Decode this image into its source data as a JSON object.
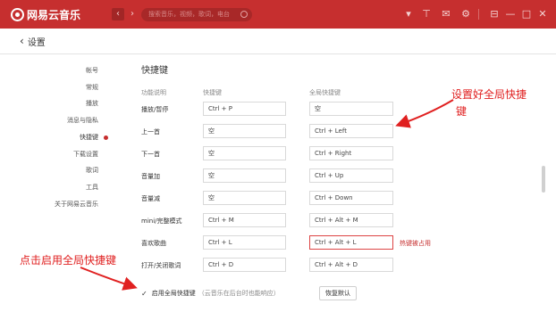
{
  "app": {
    "name": "网易云音乐"
  },
  "titlebar": {
    "search_placeholder": "搜索音乐，视频，歌词，电台",
    "back_glyph": "‹",
    "forward_glyph": "›",
    "icons": {
      "dropdown": "▾",
      "skin": "⊤",
      "mail": "✉",
      "settings": "⚙",
      "mini": "⊟",
      "minimize": "—",
      "maximize": "□",
      "close": "✕"
    }
  },
  "header": {
    "back_glyph": "‹",
    "title": "设置"
  },
  "sidebar": {
    "items": [
      {
        "label": "帐号"
      },
      {
        "label": "常规"
      },
      {
        "label": "播放"
      },
      {
        "label": "消息与隐私"
      },
      {
        "label": "快捷键",
        "active": true
      },
      {
        "label": "下载设置"
      },
      {
        "label": "歌词"
      },
      {
        "label": "工具"
      },
      {
        "label": "关于网易云音乐"
      }
    ]
  },
  "shortcuts": {
    "title": "快捷键",
    "col_function": "功能说明",
    "col_local": "快捷键",
    "col_global": "全局快捷键",
    "rows": [
      {
        "label": "播放/暂停",
        "local": "Ctrl + P",
        "global": "空"
      },
      {
        "label": "上一首",
        "local": "空",
        "global": "Ctrl + Left"
      },
      {
        "label": "下一首",
        "local": "空",
        "global": "Ctrl + Right"
      },
      {
        "label": "音量加",
        "local": "空",
        "global": "Ctrl + Up"
      },
      {
        "label": "音量减",
        "local": "空",
        "global": "Ctrl + Down"
      },
      {
        "label": "mini/完整模式",
        "local": "Ctrl + M",
        "global": "Ctrl + Alt + M"
      },
      {
        "label": "喜欢歌曲",
        "local": "Ctrl + L",
        "global": "Ctrl + Alt + L",
        "conflict": true
      },
      {
        "label": "打开/关闭歌词",
        "local": "Ctrl + D",
        "global": "Ctrl + Alt + D"
      }
    ],
    "conflict_text": "热键被占用",
    "enable_checkbox": {
      "checked": true,
      "check_glyph": "✓",
      "label": "启用全局快捷键",
      "hint": "（云音乐在后台时也能响应）"
    },
    "reset_label": "恢复默认"
  },
  "annotations": {
    "top_right": [
      "设置好全局快捷",
      "键"
    ],
    "bottom_left": "点击启用全局快捷键",
    "color": "#e02020"
  },
  "colors": {
    "brand_red": "#c62f2f"
  }
}
